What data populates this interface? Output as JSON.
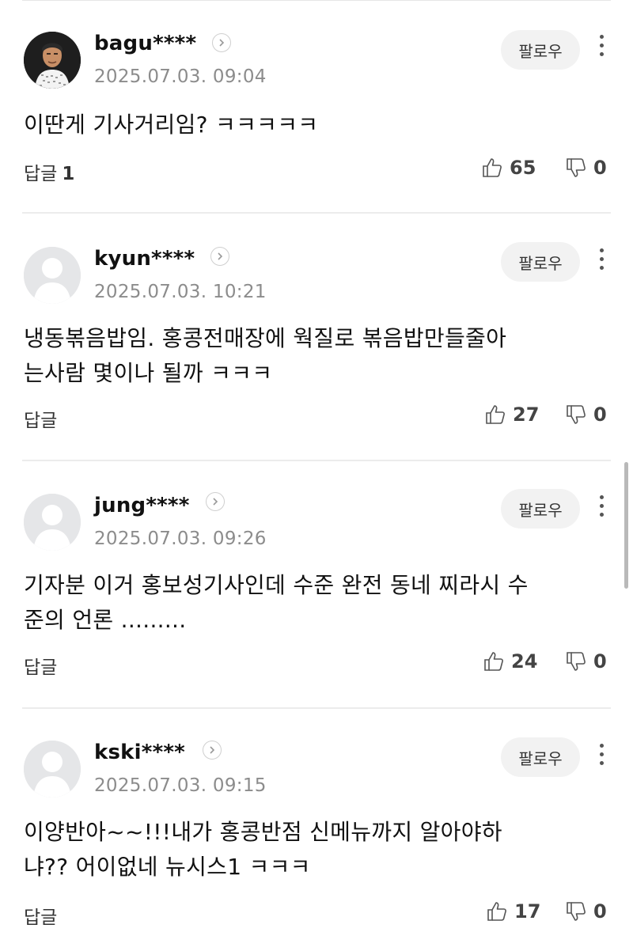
{
  "comments": [
    {
      "username": "bagu****",
      "timestamp": "2025.07.03. 09:04",
      "lines": [
        "이딴게 기사거리임? ㅋㅋㅋㅋㅋ"
      ],
      "reply_label": "답글",
      "reply_count": "1",
      "likes": "65",
      "dislikes": "0",
      "follow_label": "팔로우",
      "avatar": "photo-avatar"
    },
    {
      "username": "kyun****",
      "timestamp": "2025.07.03. 10:21",
      "lines": [
        "냉동볶음밥임. 홍콩전매장에 웍질로 볶음밥만들줄아",
        "는사람 몇이나 될까 ㅋㅋㅋ"
      ],
      "reply_label": "답글",
      "reply_count": "",
      "likes": "27",
      "dislikes": "0",
      "follow_label": "팔로우",
      "avatar": "default-avatar"
    },
    {
      "username": "jung****",
      "timestamp": "2025.07.03. 09:26",
      "lines": [
        "기자분 이거 홍보성기사인데 수준 완전 동네 찌라시 수",
        "준의 언론 ........."
      ],
      "reply_label": "답글",
      "reply_count": "",
      "likes": "24",
      "dislikes": "0",
      "follow_label": "팔로우",
      "avatar": "default-avatar"
    },
    {
      "username": "kski****",
      "timestamp": "2025.07.03. 09:15",
      "lines": [
        "이양반아~~!!!내가 홍콩반점 신메뉴까지 알아야하",
        "냐?? 어이없네 뉴시스1 ㅋㅋㅋ"
      ],
      "reply_label": "답글",
      "reply_count": "",
      "likes": "17",
      "dislikes": "0",
      "follow_label": "팔로우",
      "avatar": "default-avatar"
    }
  ],
  "icons": {
    "like": "thumbs-up-icon",
    "dislike": "thumbs-down-icon",
    "more": "more-vertical-icon",
    "profile": "chevron-right-icon"
  },
  "colors": {
    "text": "#111111",
    "muted": "#8c8c8c",
    "follow_bg": "#f2f2f2",
    "avatar_bg": "#e5e6e8"
  }
}
